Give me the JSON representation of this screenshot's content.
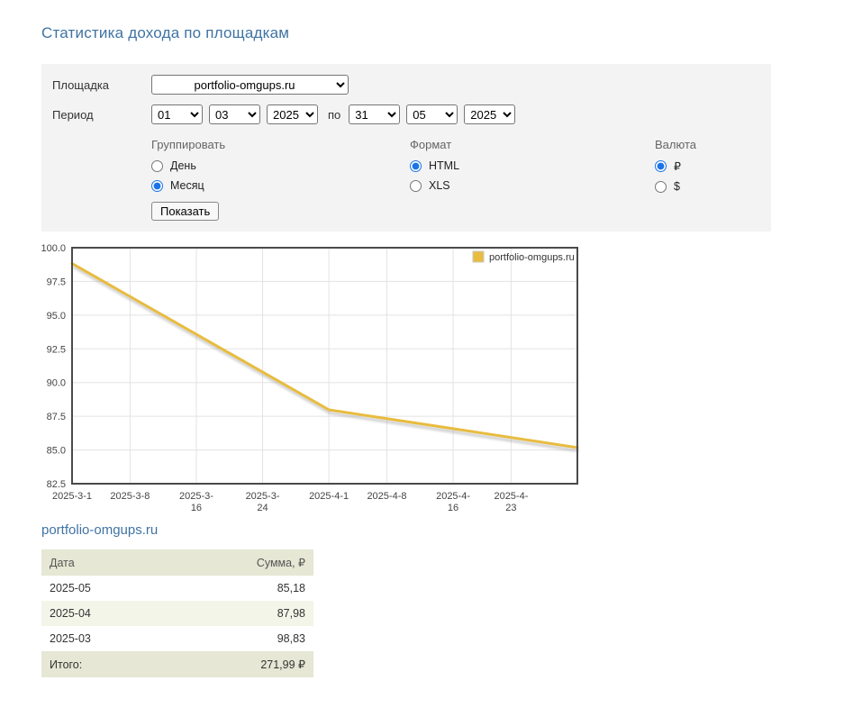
{
  "page": {
    "title": "Статистика дохода по площадкам"
  },
  "form": {
    "platform_label": "Площадка",
    "platform_value": "portfolio-omgups.ru",
    "period_label": "Период",
    "period_separator": "по",
    "period_from": {
      "day": "01",
      "month": "03",
      "year": "2025"
    },
    "period_to": {
      "day": "31",
      "month": "05",
      "year": "2025"
    },
    "group": {
      "label": "Группировать",
      "options": [
        {
          "label": "День",
          "selected": false
        },
        {
          "label": "Месяц",
          "selected": true
        }
      ]
    },
    "format": {
      "label": "Формат",
      "options": [
        {
          "label": "HTML",
          "selected": true
        },
        {
          "label": "XLS",
          "selected": false
        }
      ]
    },
    "currency": {
      "label": "Валюта",
      "options": [
        {
          "label": "₽",
          "selected": true
        },
        {
          "label": "$",
          "selected": false
        }
      ]
    },
    "submit_label": "Показать"
  },
  "chart_data": {
    "type": "line",
    "title": "",
    "xlabel": "",
    "ylabel": "",
    "ylim": [
      82.5,
      100.0
    ],
    "y_ticks": [
      82.5,
      85.0,
      87.5,
      90.0,
      92.5,
      95.0,
      97.5,
      100.0
    ],
    "x_range_days": [
      0,
      61
    ],
    "x_tick_days": [
      0,
      7,
      15,
      23,
      31,
      38,
      46,
      53
    ],
    "x_tick_labels": [
      "2025-3-1",
      "2025-3-8",
      "2025-3-\n16",
      "2025-3-\n24",
      "2025-4-1",
      "2025-4-8",
      "2025-4-\n16",
      "2025-4-\n23"
    ],
    "grid": true,
    "legend_position": "top-right",
    "series": [
      {
        "name": "portfolio-omgups.ru",
        "color": "#e8bc3f",
        "points": [
          {
            "date": "2025-03-01",
            "x_day": 0,
            "value": 98.83
          },
          {
            "date": "2025-04-01",
            "x_day": 31,
            "value": 87.98
          },
          {
            "date": "2025-05-01",
            "x_day": 61,
            "value": 85.18
          }
        ]
      }
    ]
  },
  "table": {
    "heading": "portfolio-omgups.ru",
    "columns": [
      "Дата",
      "Сумма, ₽"
    ],
    "rows": [
      [
        "2025-05",
        "85,18"
      ],
      [
        "2025-04",
        "87,98"
      ],
      [
        "2025-03",
        "98,83"
      ]
    ],
    "footer": [
      "Итого:",
      "271,99 ₽"
    ]
  },
  "colors": {
    "heading_blue": "#3f73a3",
    "line_gold": "#e8bc3f",
    "panel_bg": "#f3f3f3",
    "table_header_bg": "#e6e7d4",
    "table_alt_row_bg": "#f4f5e9",
    "chart_border": "#4a4a4a",
    "gridline": "#e3e3e3"
  }
}
